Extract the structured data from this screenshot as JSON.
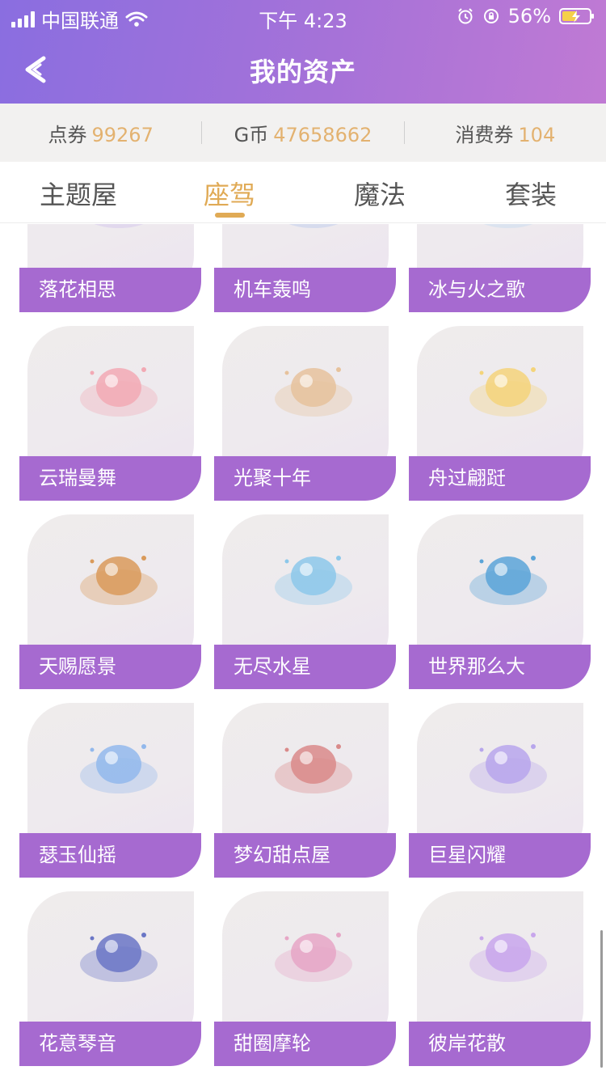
{
  "status": {
    "carrier": "中国联通",
    "time": "下午 4:23",
    "battery": "56%"
  },
  "nav": {
    "title": "我的资产"
  },
  "assets": [
    {
      "label": "点券",
      "value": "99267"
    },
    {
      "label": "G币",
      "value": "47658662"
    },
    {
      "label": "消费券",
      "value": "104"
    }
  ],
  "tabs": [
    "主题屋",
    "座驾",
    "魔法",
    "套装"
  ],
  "active_tab": "座驾",
  "items": [
    {
      "name": "落花相思",
      "icon": "ride-icon",
      "color": "#c9b6ea"
    },
    {
      "name": "机车轰鸣",
      "icon": "ride-icon",
      "color": "#a9c0ec"
    },
    {
      "name": "冰与火之歌",
      "icon": "ride-icon",
      "color": "#b8d7f2"
    },
    {
      "name": "云瑞曼舞",
      "icon": "cake-ride-icon",
      "color": "#f2a9b4"
    },
    {
      "name": "光聚十年",
      "icon": "feather-ride-icon",
      "color": "#e6c29c"
    },
    {
      "name": "舟过翩跹",
      "icon": "paper-boat-icon",
      "color": "#f4d47a"
    },
    {
      "name": "天赐愿景",
      "icon": "lantern-cloud-icon",
      "color": "#d99a5a"
    },
    {
      "name": "无尽水星",
      "icon": "water-ring-icon",
      "color": "#8cc8ea"
    },
    {
      "name": "世界那么大",
      "icon": "planet-icon",
      "color": "#5aa4d8"
    },
    {
      "name": "瑟玉仙摇",
      "icon": "jade-swirl-icon",
      "color": "#92b8ec"
    },
    {
      "name": "梦幻甜点屋",
      "icon": "dessert-ride-icon",
      "color": "#d98a8a"
    },
    {
      "name": "巨星闪耀",
      "icon": "crystal-ride-icon",
      "color": "#b7a6ec"
    },
    {
      "name": "花意琴音",
      "icon": "piano-ride-icon",
      "color": "#6a76c6"
    },
    {
      "name": "甜圈摩轮",
      "icon": "ferris-wheel-icon",
      "color": "#e6a6c6"
    },
    {
      "name": "彼岸花散",
      "icon": "moon-cloud-icon",
      "color": "#c8a6ec"
    }
  ]
}
